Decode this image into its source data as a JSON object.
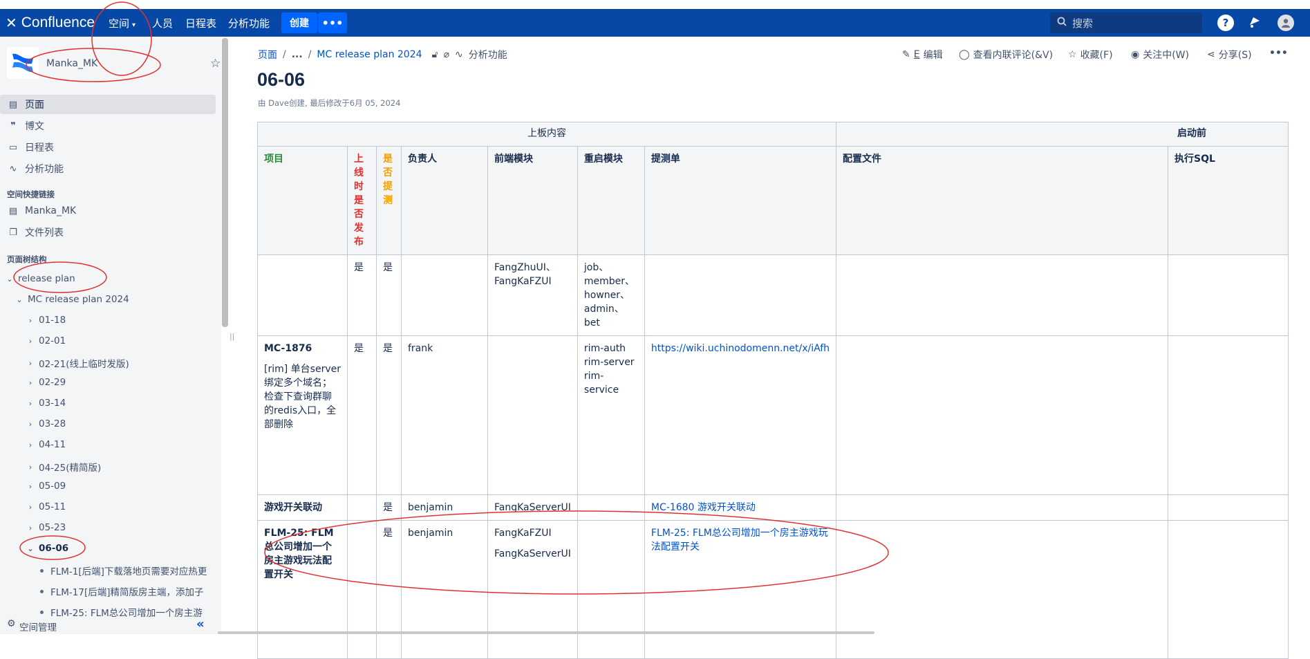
{
  "topbar": {
    "product": "Confluence",
    "nav": [
      "空间",
      "人员",
      "日程表",
      "分析功能"
    ],
    "create_label": "创建",
    "more_label": "•••",
    "search_placeholder": "搜索",
    "help_icon": "?",
    "colors": {
      "bar": "#0747a6",
      "button": "#0065ff"
    }
  },
  "sidebar": {
    "space_name": "Manka_MK",
    "items": [
      {
        "label": "页面",
        "icon": "page-icon"
      },
      {
        "label": "博文",
        "icon": "quote-icon"
      },
      {
        "label": "日程表",
        "icon": "calendar-icon"
      },
      {
        "label": "分析功能",
        "icon": "analytics-icon"
      }
    ],
    "shortcuts_heading": "空间快捷链接",
    "shortcuts": [
      {
        "label": "Manka_MK",
        "icon": "page-icon"
      },
      {
        "label": "文件列表",
        "icon": "files-icon"
      }
    ],
    "tree_heading": "页面树结构",
    "tree": {
      "root": "release plan",
      "child": "MC release plan 2024",
      "pages": [
        "01-18",
        "02-01",
        "02-21(线上临时发版)",
        "02-29",
        "03-14",
        "03-28",
        "04-11",
        "04-25(精简版)",
        "05-09",
        "05-11",
        "05-23"
      ],
      "current": "06-06",
      "subpages": [
        "FLM-1[后端]下载落地页需要对应热更",
        "FLM-17[后端]精简版房主端，添加子",
        "FLM-25: FLM总公司增加一个房主游"
      ]
    },
    "footer_label": "空间管理",
    "collapse_icon": "«"
  },
  "breadcrumb": {
    "root": "页面",
    "ellipsis": "...",
    "parent": "MC release plan 2024",
    "analytics": "分析功能"
  },
  "actions": {
    "edit": "编辑",
    "edit_key": "E",
    "comments": "查看内联评论(&V)",
    "favorite": "收藏(F)",
    "watching": "关注中(W)",
    "share": "分享(S)",
    "more": "•••"
  },
  "page": {
    "title": "06-06",
    "byline": "由 Dave创建, 最后修改于6月 05, 2024"
  },
  "table": {
    "group_headers": [
      "上板内容",
      "启动前"
    ],
    "headers": [
      "项目",
      "上线时是否发布",
      "是否提测",
      "负责人",
      "前端模块",
      "重启模块",
      "提测单",
      "配置文件",
      "执行SQL"
    ],
    "header_chars_release": [
      "上",
      "线",
      "时",
      "是",
      "否",
      "发",
      "布"
    ],
    "header_chars_test": [
      "是",
      "否",
      "提",
      "测"
    ],
    "rows": [
      {
        "project": "",
        "project_desc": "",
        "release": "是",
        "tested": "是",
        "owner": "",
        "frontend": [
          "FangZhuUI、",
          "FangKaFZUI"
        ],
        "restart": [
          "job、",
          "member、",
          "howner、",
          "admin、bet"
        ],
        "ticket": "",
        "config": "",
        "sql": ""
      },
      {
        "project": "MC-1876",
        "project_desc": "[rim] 单台server绑定多个域名；检查下查询群聊的redis入口，全部删除",
        "release": "是",
        "tested": "是",
        "owner": "frank",
        "frontend": [],
        "restart": [
          "rim-auth",
          "rim-server",
          "rim-service"
        ],
        "ticket": "https://wiki.uchinodomenn.net/x/iAfh",
        "config": "",
        "sql": ""
      },
      {
        "project": "游戏开关联动",
        "project_desc": "",
        "release": "",
        "tested": "是",
        "owner": "benjamin",
        "frontend": [
          "FangKaServerUI"
        ],
        "restart": [],
        "ticket": "MC-1680 游戏开关联动",
        "config": "",
        "sql": ""
      },
      {
        "project": "FLM-25: FLM总公司增加一个房主游戏玩法配置开关",
        "project_desc": "",
        "release": "",
        "tested": "是",
        "owner": "benjamin",
        "frontend": [
          "FangKaFZUI",
          "FangKaServerUI"
        ],
        "restart": [],
        "ticket": "FLM-25: FLM总公司增加一个房主游戏玩法配置开关",
        "config": "",
        "sql": ""
      }
    ]
  }
}
